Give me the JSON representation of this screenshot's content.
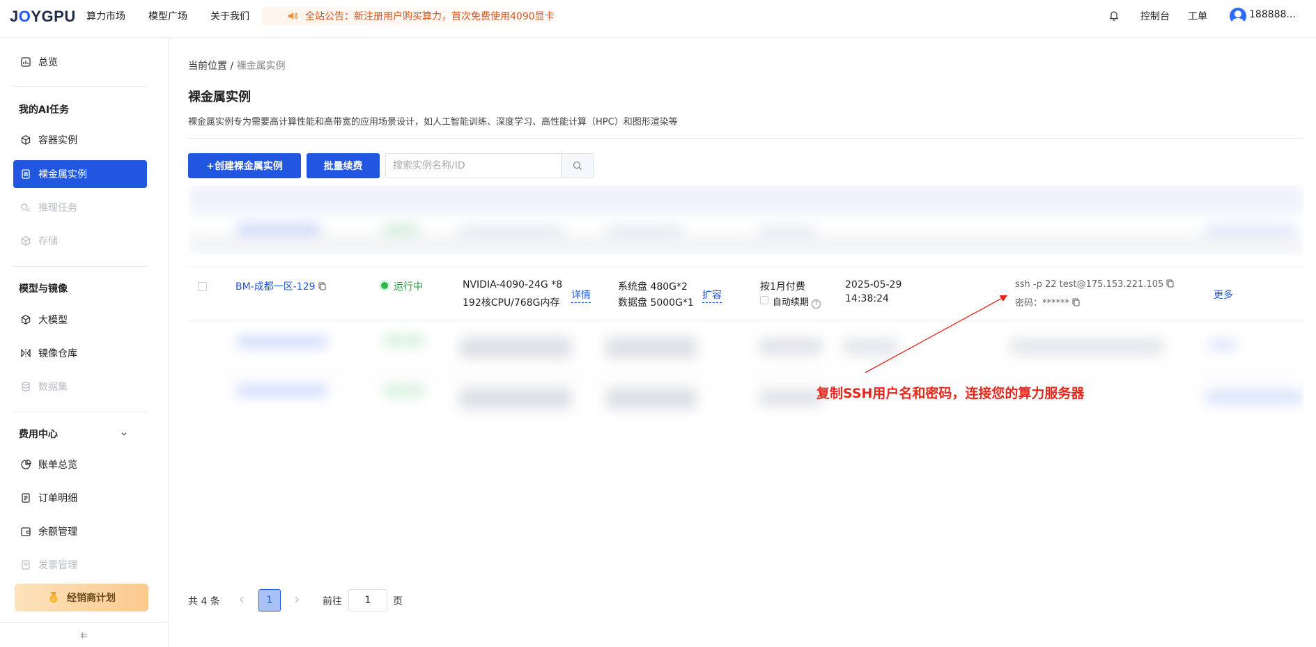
{
  "header": {
    "logo": "JOYGPU",
    "nav": [
      "算力市场",
      "模型广场",
      "关于我们"
    ],
    "announcement": "全站公告：新注册用户购买算力，首次免费使用4090显卡",
    "console": "控制台",
    "ticket": "工单",
    "username": "188888...",
    "accent_color": "#2157e0"
  },
  "sidebar": {
    "overview": "总览",
    "sections": {
      "ai_tasks": "我的AI任务",
      "models": "模型与镜像",
      "billing": "费用中心"
    },
    "items": {
      "container": "容器实例",
      "baremetal": "裸金属实例",
      "inference": "推理任务",
      "storage": "存储",
      "llm": "大模型",
      "image_repo": "镜像仓库",
      "dataset": "数据集",
      "bill_overview": "账单总览",
      "orders": "订单明细",
      "balance": "余额管理",
      "invoice": "发票管理"
    },
    "promo": "经销商计划",
    "collapse": "⇇"
  },
  "main": {
    "breadcrumb": {
      "prefix": "当前位置",
      "sep": "/",
      "current": "裸金属实例"
    },
    "title": "裸金属实例",
    "description": "裸金属实例专为需要高计算性能和高带宽的应用场景设计，如人工智能训练、深度学习、高性能计算（HPC）和图形渲染等",
    "create_button": "+创建裸金属实例",
    "renew_button": "批量续费",
    "search_placeholder": "搜索实例名称/ID",
    "row": {
      "name": "BM-成都一区-129",
      "status": "运行中",
      "gpu": "NVIDIA-4090-24G *8",
      "cpu_mem": "192核CPU/768G内存",
      "detail_link": "详情",
      "system_disk": "系统盘 480G*2",
      "data_disk": "数据盘 5000G*1",
      "expand_link": "扩容",
      "billing": "按1月付费",
      "auto_renew": "自动续期",
      "date": "2025-05-29",
      "time": "14:38:24",
      "ssh": "ssh -p 22 test@175.153.221.105",
      "password_label": "密码：",
      "password": "******",
      "more": "更多"
    },
    "annotation": "复制SSH用户名和密码，连接您的算力服务器"
  },
  "pagination": {
    "total": "共 4 条",
    "current": "1",
    "goto_label": "前往",
    "goto_value": "1",
    "unit": "页"
  }
}
